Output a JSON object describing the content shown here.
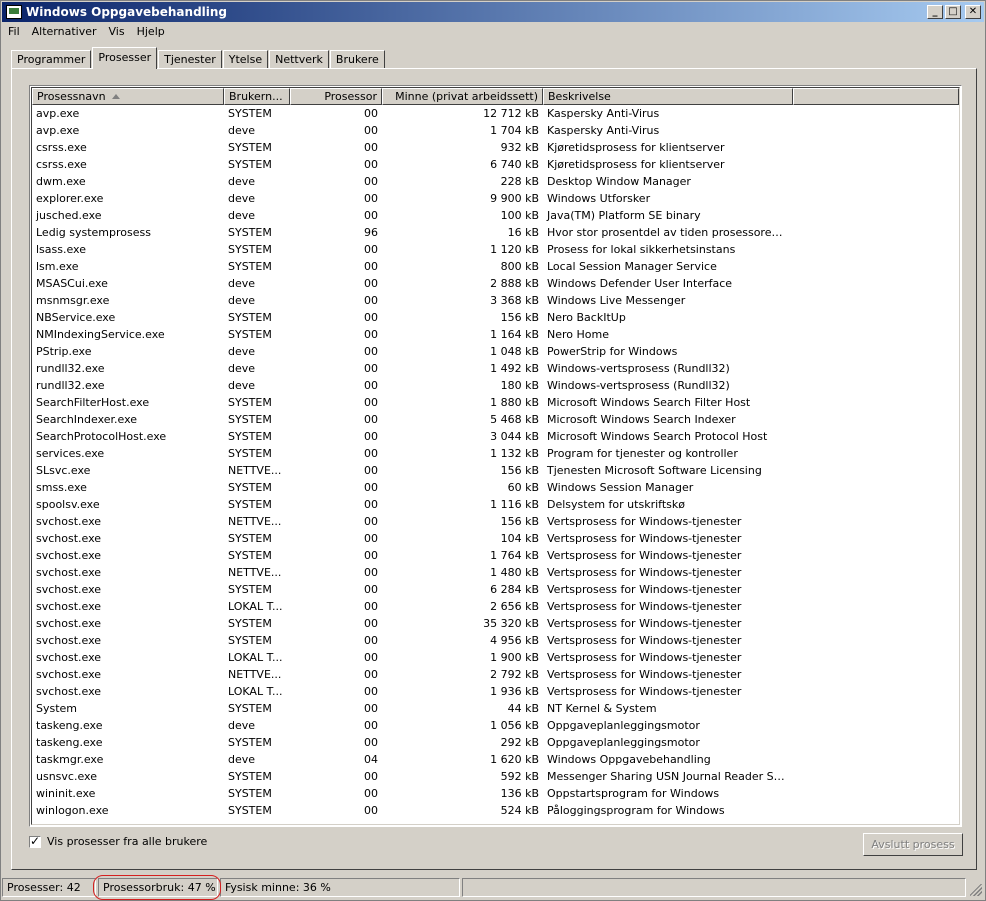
{
  "window": {
    "title": "Windows Oppgavebehandling",
    "minimize": "_",
    "maximize": "□",
    "close": "✕"
  },
  "menu": [
    "Fil",
    "Alternativer",
    "Vis",
    "Hjelp"
  ],
  "tabs": [
    "Programmer",
    "Prosesser",
    "Tjenester",
    "Ytelse",
    "Nettverk",
    "Brukere"
  ],
  "active_tab": "Prosesser",
  "columns": {
    "name": "Prosessnavn",
    "user": "Brukern...",
    "cpu": "Prosessor",
    "mem": "Minne (privat arbeidssett)",
    "desc": "Beskrivelse"
  },
  "processes": [
    {
      "name": "avp.exe",
      "user": "SYSTEM",
      "cpu": "00",
      "mem": "12 712 kB",
      "desc": "Kaspersky Anti-Virus"
    },
    {
      "name": "avp.exe",
      "user": "deve",
      "cpu": "00",
      "mem": "1 704 kB",
      "desc": "Kaspersky Anti-Virus"
    },
    {
      "name": "csrss.exe",
      "user": "SYSTEM",
      "cpu": "00",
      "mem": "932 kB",
      "desc": "Kjøretidsprosess for klientserver"
    },
    {
      "name": "csrss.exe",
      "user": "SYSTEM",
      "cpu": "00",
      "mem": "6 740 kB",
      "desc": "Kjøretidsprosess for klientserver"
    },
    {
      "name": "dwm.exe",
      "user": "deve",
      "cpu": "00",
      "mem": "228 kB",
      "desc": "Desktop Window Manager"
    },
    {
      "name": "explorer.exe",
      "user": "deve",
      "cpu": "00",
      "mem": "9 900 kB",
      "desc": "Windows Utforsker"
    },
    {
      "name": "jusched.exe",
      "user": "deve",
      "cpu": "00",
      "mem": "100 kB",
      "desc": "Java(TM) Platform SE binary"
    },
    {
      "name": "Ledig systemprosess",
      "user": "SYSTEM",
      "cpu": "96",
      "mem": "16 kB",
      "desc": "Hvor stor prosentdel av tiden prosessoren er in..."
    },
    {
      "name": "lsass.exe",
      "user": "SYSTEM",
      "cpu": "00",
      "mem": "1 120 kB",
      "desc": "Prosess for lokal sikkerhetsinstans"
    },
    {
      "name": "lsm.exe",
      "user": "SYSTEM",
      "cpu": "00",
      "mem": "800 kB",
      "desc": "Local Session Manager Service"
    },
    {
      "name": "MSASCui.exe",
      "user": "deve",
      "cpu": "00",
      "mem": "2 888 kB",
      "desc": "Windows Defender User Interface"
    },
    {
      "name": "msnmsgr.exe",
      "user": "deve",
      "cpu": "00",
      "mem": "3 368 kB",
      "desc": "Windows Live Messenger"
    },
    {
      "name": "NBService.exe",
      "user": "SYSTEM",
      "cpu": "00",
      "mem": "156 kB",
      "desc": "Nero BackItUp"
    },
    {
      "name": "NMIndexingService.exe",
      "user": "SYSTEM",
      "cpu": "00",
      "mem": "1 164 kB",
      "desc": "Nero Home"
    },
    {
      "name": "PStrip.exe",
      "user": "deve",
      "cpu": "00",
      "mem": "1 048 kB",
      "desc": "PowerStrip for Windows"
    },
    {
      "name": "rundll32.exe",
      "user": "deve",
      "cpu": "00",
      "mem": "1 492 kB",
      "desc": "Windows-vertsprosess (Rundll32)"
    },
    {
      "name": "rundll32.exe",
      "user": "deve",
      "cpu": "00",
      "mem": "180 kB",
      "desc": "Windows-vertsprosess (Rundll32)"
    },
    {
      "name": "SearchFilterHost.exe",
      "user": "SYSTEM",
      "cpu": "00",
      "mem": "1 880 kB",
      "desc": "Microsoft Windows Search Filter Host"
    },
    {
      "name": "SearchIndexer.exe",
      "user": "SYSTEM",
      "cpu": "00",
      "mem": "5 468 kB",
      "desc": "Microsoft Windows Search Indexer"
    },
    {
      "name": "SearchProtocolHost.exe",
      "user": "SYSTEM",
      "cpu": "00",
      "mem": "3 044 kB",
      "desc": "Microsoft Windows Search Protocol Host"
    },
    {
      "name": "services.exe",
      "user": "SYSTEM",
      "cpu": "00",
      "mem": "1 132 kB",
      "desc": "Program for tjenester og kontroller"
    },
    {
      "name": "SLsvc.exe",
      "user": "NETTVE...",
      "cpu": "00",
      "mem": "156 kB",
      "desc": "Tjenesten Microsoft Software Licensing"
    },
    {
      "name": "smss.exe",
      "user": "SYSTEM",
      "cpu": "00",
      "mem": "60 kB",
      "desc": "Windows Session Manager"
    },
    {
      "name": "spoolsv.exe",
      "user": "SYSTEM",
      "cpu": "00",
      "mem": "1 116 kB",
      "desc": "Delsystem for utskriftskø"
    },
    {
      "name": "svchost.exe",
      "user": "NETTVE...",
      "cpu": "00",
      "mem": "156 kB",
      "desc": "Vertsprosess for Windows-tjenester"
    },
    {
      "name": "svchost.exe",
      "user": "SYSTEM",
      "cpu": "00",
      "mem": "104 kB",
      "desc": "Vertsprosess for Windows-tjenester"
    },
    {
      "name": "svchost.exe",
      "user": "SYSTEM",
      "cpu": "00",
      "mem": "1 764 kB",
      "desc": "Vertsprosess for Windows-tjenester"
    },
    {
      "name": "svchost.exe",
      "user": "NETTVE...",
      "cpu": "00",
      "mem": "1 480 kB",
      "desc": "Vertsprosess for Windows-tjenester"
    },
    {
      "name": "svchost.exe",
      "user": "SYSTEM",
      "cpu": "00",
      "mem": "6 284 kB",
      "desc": "Vertsprosess for Windows-tjenester"
    },
    {
      "name": "svchost.exe",
      "user": "LOKAL T...",
      "cpu": "00",
      "mem": "2 656 kB",
      "desc": "Vertsprosess for Windows-tjenester"
    },
    {
      "name": "svchost.exe",
      "user": "SYSTEM",
      "cpu": "00",
      "mem": "35 320 kB",
      "desc": "Vertsprosess for Windows-tjenester"
    },
    {
      "name": "svchost.exe",
      "user": "SYSTEM",
      "cpu": "00",
      "mem": "4 956 kB",
      "desc": "Vertsprosess for Windows-tjenester"
    },
    {
      "name": "svchost.exe",
      "user": "LOKAL T...",
      "cpu": "00",
      "mem": "1 900 kB",
      "desc": "Vertsprosess for Windows-tjenester"
    },
    {
      "name": "svchost.exe",
      "user": "NETTVE...",
      "cpu": "00",
      "mem": "2 792 kB",
      "desc": "Vertsprosess for Windows-tjenester"
    },
    {
      "name": "svchost.exe",
      "user": "LOKAL T...",
      "cpu": "00",
      "mem": "1 936 kB",
      "desc": "Vertsprosess for Windows-tjenester"
    },
    {
      "name": "System",
      "user": "SYSTEM",
      "cpu": "00",
      "mem": "44 kB",
      "desc": "NT Kernel & System"
    },
    {
      "name": "taskeng.exe",
      "user": "deve",
      "cpu": "00",
      "mem": "1 056 kB",
      "desc": "Oppgaveplanleggingsmotor"
    },
    {
      "name": "taskeng.exe",
      "user": "SYSTEM",
      "cpu": "00",
      "mem": "292 kB",
      "desc": "Oppgaveplanleggingsmotor"
    },
    {
      "name": "taskmgr.exe",
      "user": "deve",
      "cpu": "04",
      "mem": "1 620 kB",
      "desc": "Windows Oppgavebehandling"
    },
    {
      "name": "usnsvc.exe",
      "user": "SYSTEM",
      "cpu": "00",
      "mem": "592 kB",
      "desc": "Messenger Sharing USN Journal Reader Service"
    },
    {
      "name": "wininit.exe",
      "user": "SYSTEM",
      "cpu": "00",
      "mem": "136 kB",
      "desc": "Oppstartsprogram for Windows"
    },
    {
      "name": "winlogon.exe",
      "user": "SYSTEM",
      "cpu": "00",
      "mem": "524 kB",
      "desc": "Påloggingsprogram for Windows"
    }
  ],
  "show_all_users": {
    "label": "Vis prosesser fra alle brukere",
    "checked": true
  },
  "end_process_button": "Avslutt prosess",
  "status": {
    "processes": "Prosesser: 42",
    "cpu_usage": "Prosessorbruk: 47 %",
    "memory": "Fysisk minne: 36 %"
  },
  "colors": {
    "titlebar_start": "#0a246a",
    "titlebar_end": "#a6caf0",
    "highlight_ring": "#d42020"
  }
}
